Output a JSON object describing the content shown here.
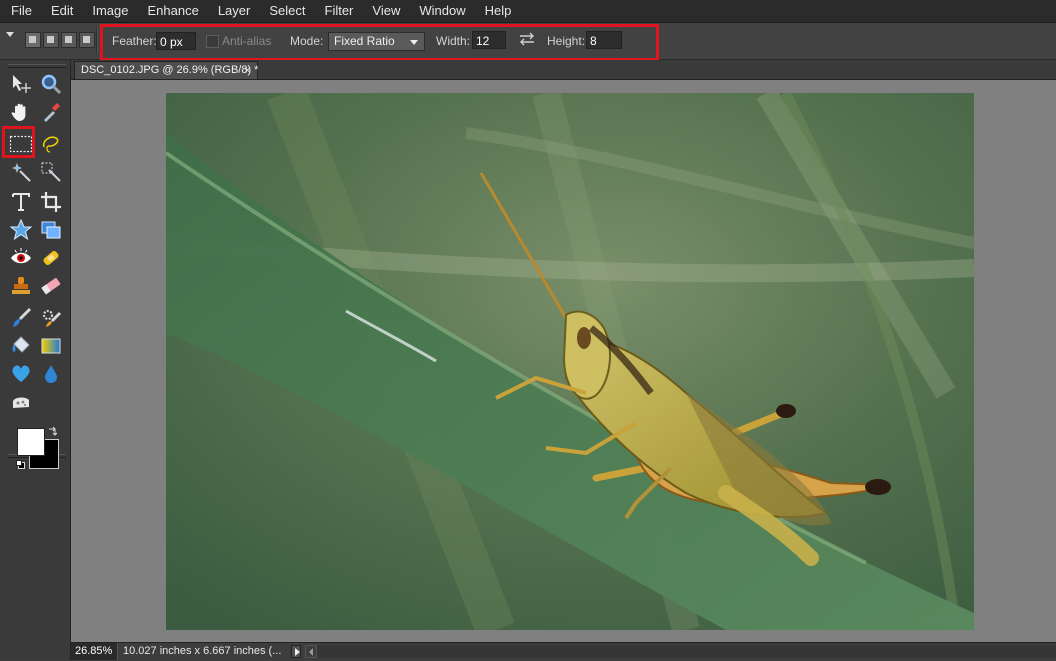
{
  "menu": [
    "File",
    "Edit",
    "Image",
    "Enhance",
    "Layer",
    "Select",
    "Filter",
    "View",
    "Window",
    "Help"
  ],
  "options": {
    "feather_label": "Feather:",
    "feather_value": "0 px",
    "antialias_label": "Anti-alias",
    "mode_label": "Mode:",
    "mode_value": "Fixed Ratio",
    "width_label": "Width:",
    "width_value": "12",
    "height_label": "Height:",
    "height_value": "8"
  },
  "document": {
    "tab_title": "DSC_0102.JPG @ 26.9% (RGB/8) *",
    "close": "×"
  },
  "status": {
    "zoom": "26.85%",
    "dimensions": "10.027 inches x 6.667 inches (..."
  },
  "colors": {
    "highlight": "#e0141e",
    "foreground": "#ffffff",
    "background": "#000000"
  },
  "tools": [
    "move-tool-icon",
    "zoom-tool-icon",
    "hand-tool-icon",
    "eyedropper-tool-icon",
    "rectangular-marquee-tool-icon",
    "lasso-tool-icon",
    "magic-wand-tool-icon",
    "quick-selection-tool-icon",
    "type-tool-icon",
    "crop-tool-icon",
    "cookie-cutter-tool-icon",
    "straighten-tool-icon",
    "red-eye-tool-icon",
    "healing-brush-tool-icon",
    "clone-stamp-tool-icon",
    "eraser-tool-icon",
    "brush-tool-icon",
    "smart-brush-tool-icon",
    "paint-bucket-tool-icon",
    "gradient-tool-icon",
    "custom-shape-tool-icon",
    "blur-tool-icon",
    "sponge-tool-icon"
  ]
}
